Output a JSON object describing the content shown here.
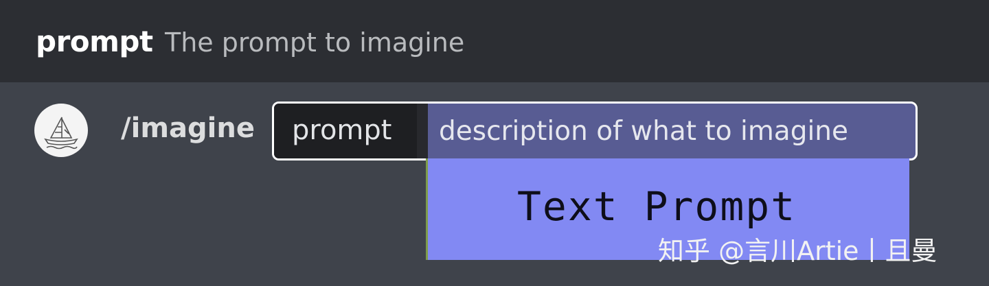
{
  "option_header": {
    "name": "prompt",
    "description": "The prompt to imagine"
  },
  "command_row": {
    "avatar_icon": "sailboat-logo-icon",
    "command": "/imagine",
    "param_label": "prompt",
    "param_placeholder": "description of what to imagine"
  },
  "annotation": {
    "label": "Text Prompt"
  },
  "watermark": {
    "text": "知乎 @言川Artie丨且曼"
  },
  "colors": {
    "header_bg": "#2c2e33",
    "body_bg": "#3f434b",
    "input_fill": "#585c93",
    "annotation_fill": "#8289f3"
  }
}
